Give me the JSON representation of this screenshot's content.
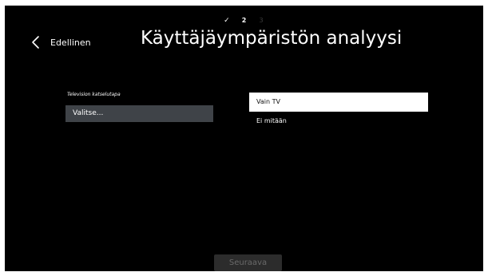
{
  "steps": [
    {
      "label": "✓",
      "state": "done"
    },
    {
      "label": "2",
      "state": "current"
    },
    {
      "label": "3",
      "state": "future"
    }
  ],
  "header": {
    "back_label": "Edellinen",
    "title": "Käyttäjäympäristön analyysi"
  },
  "form": {
    "field_label": "Television katselutapa",
    "select_value": "Valitse..."
  },
  "options": [
    {
      "label": "Vain TV",
      "selected": true
    },
    {
      "label": "Ei mitään",
      "selected": false
    }
  ],
  "footer": {
    "next_label": "Seuraava"
  },
  "colors": {
    "background": "#000000",
    "select_bg": "#3f4348",
    "selected_option_bg": "#ffffff",
    "disabled_button_bg": "#2c2c2c"
  }
}
